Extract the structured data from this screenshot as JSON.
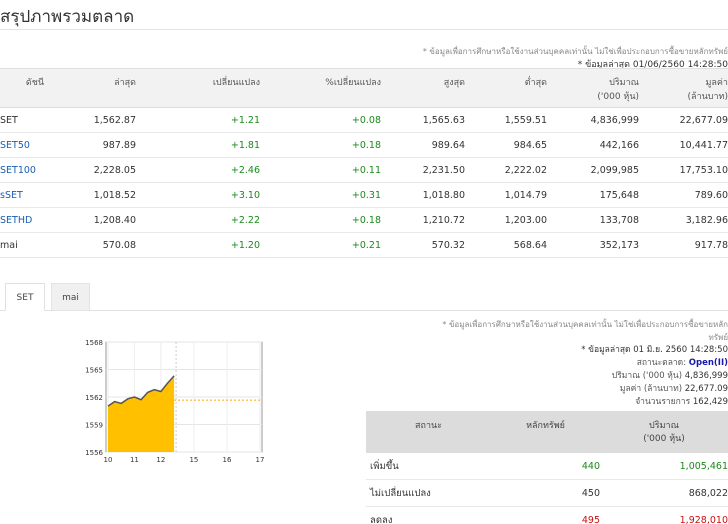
{
  "page_title": "สรุปภาพรวมตลาด",
  "disclaimer_top": "* ข้อมูลเพื่อการศึกษาหรือใช้งานส่วนบุคคลเท่านั้น ไม่ใช่เพื่อประกอบการซื้อขายหลักทรัพย์",
  "updated_top": "* ข้อมูลล่าสุด 01/06/2560 14:28:50",
  "index_table": {
    "headers": {
      "index": "ดัชนี",
      "last": "ล่าสุด",
      "change": "เปลี่ยนแปลง",
      "pct_change": "%เปลี่ยนแปลง",
      "high": "สูงสุด",
      "low": "ต่ำสุด",
      "volume": "ปริมาณ",
      "volume_unit": "('000 หุ้น)",
      "value": "มูลค่า",
      "value_unit": "(ล้านบาท)"
    },
    "rows": [
      {
        "name": "SET",
        "last": "1,562.87",
        "change": "+1.21",
        "pct": "+0.08",
        "high": "1,565.63",
        "low": "1,559.51",
        "volume": "4,836,999",
        "value": "22,677.09"
      },
      {
        "name": "SET50",
        "last": "987.89",
        "change": "+1.81",
        "pct": "+0.18",
        "high": "989.64",
        "low": "984.65",
        "volume": "442,166",
        "value": "10,441.77"
      },
      {
        "name": "SET100",
        "last": "2,228.05",
        "change": "+2.46",
        "pct": "+0.11",
        "high": "2,231.50",
        "low": "2,222.02",
        "volume": "2,099,985",
        "value": "17,753.10"
      },
      {
        "name": "sSET",
        "last": "1,018.52",
        "change": "+3.10",
        "pct": "+0.31",
        "high": "1,018.80",
        "low": "1,014.79",
        "volume": "175,648",
        "value": "789.60"
      },
      {
        "name": "SETHD",
        "last": "1,208.40",
        "change": "+2.22",
        "pct": "+0.18",
        "high": "1,210.72",
        "low": "1,203.00",
        "volume": "133,708",
        "value": "3,182.96"
      },
      {
        "name": "mai",
        "last": "570.08",
        "change": "+1.20",
        "pct": "+0.21",
        "high": "570.32",
        "low": "568.64",
        "volume": "352,173",
        "value": "917.78"
      }
    ]
  },
  "tabs": [
    {
      "label": "SET"
    },
    {
      "label": "mai"
    }
  ],
  "chart_data": {
    "type": "area",
    "x": [
      10.0,
      10.25,
      10.5,
      10.75,
      11.0,
      11.25,
      11.5,
      11.75,
      12.0,
      12.25,
      12.5
    ],
    "values": [
      1561.0,
      1561.5,
      1561.3,
      1561.8,
      1562.0,
      1561.7,
      1562.5,
      1562.8,
      1562.6,
      1563.5,
      1564.3
    ],
    "reference": 1561.66,
    "xticks": [
      "10",
      "11",
      "12",
      "15",
      "16",
      "17"
    ],
    "yticks": [
      "1568",
      "1565",
      "1562",
      "1559",
      "1556"
    ],
    "ylim": [
      1556,
      1568
    ],
    "colors": {
      "fill": "#ffc000",
      "line": "#555555",
      "reference": "#ffa500"
    }
  },
  "disclaimer_bottom_1": "* ข้อมูลเพื่อการศึกษาหรือใช้งานส่วนบุคคลเท่านั้น ไม่ใช่เพื่อประกอบการซื้อขายหลัก",
  "disclaimer_bottom_2": "ทรัพย์",
  "market_info": {
    "updated": "* ข้อมูลล่าสุด 01 มิ.ย. 2560 14:28:50",
    "status_label": "สถานะตลาด:",
    "status_value": "Open(II)",
    "volume_label": "ปริมาณ ('000 หุ้น)",
    "volume_value": "4,836,999",
    "value_label": "มูลค่า (ล้านบาท)",
    "value_value": "22,677.09",
    "deals_label": "จำนวนรายการ",
    "deals_value": "162,429"
  },
  "stat_table": {
    "headers": {
      "status": "สถานะ",
      "securities": "หลักทรัพย์",
      "volume": "ปริมาณ",
      "volume_unit": "('000 หุ้น)"
    },
    "rows": [
      {
        "label": "เพิ่มขึ้น",
        "count": "440",
        "volume": "1,005,461"
      },
      {
        "label": "ไม่เปลี่ยนแปลง",
        "count": "450",
        "volume": "868,022"
      },
      {
        "label": "ลดลง",
        "count": "495",
        "volume": "1,928,010"
      }
    ]
  }
}
